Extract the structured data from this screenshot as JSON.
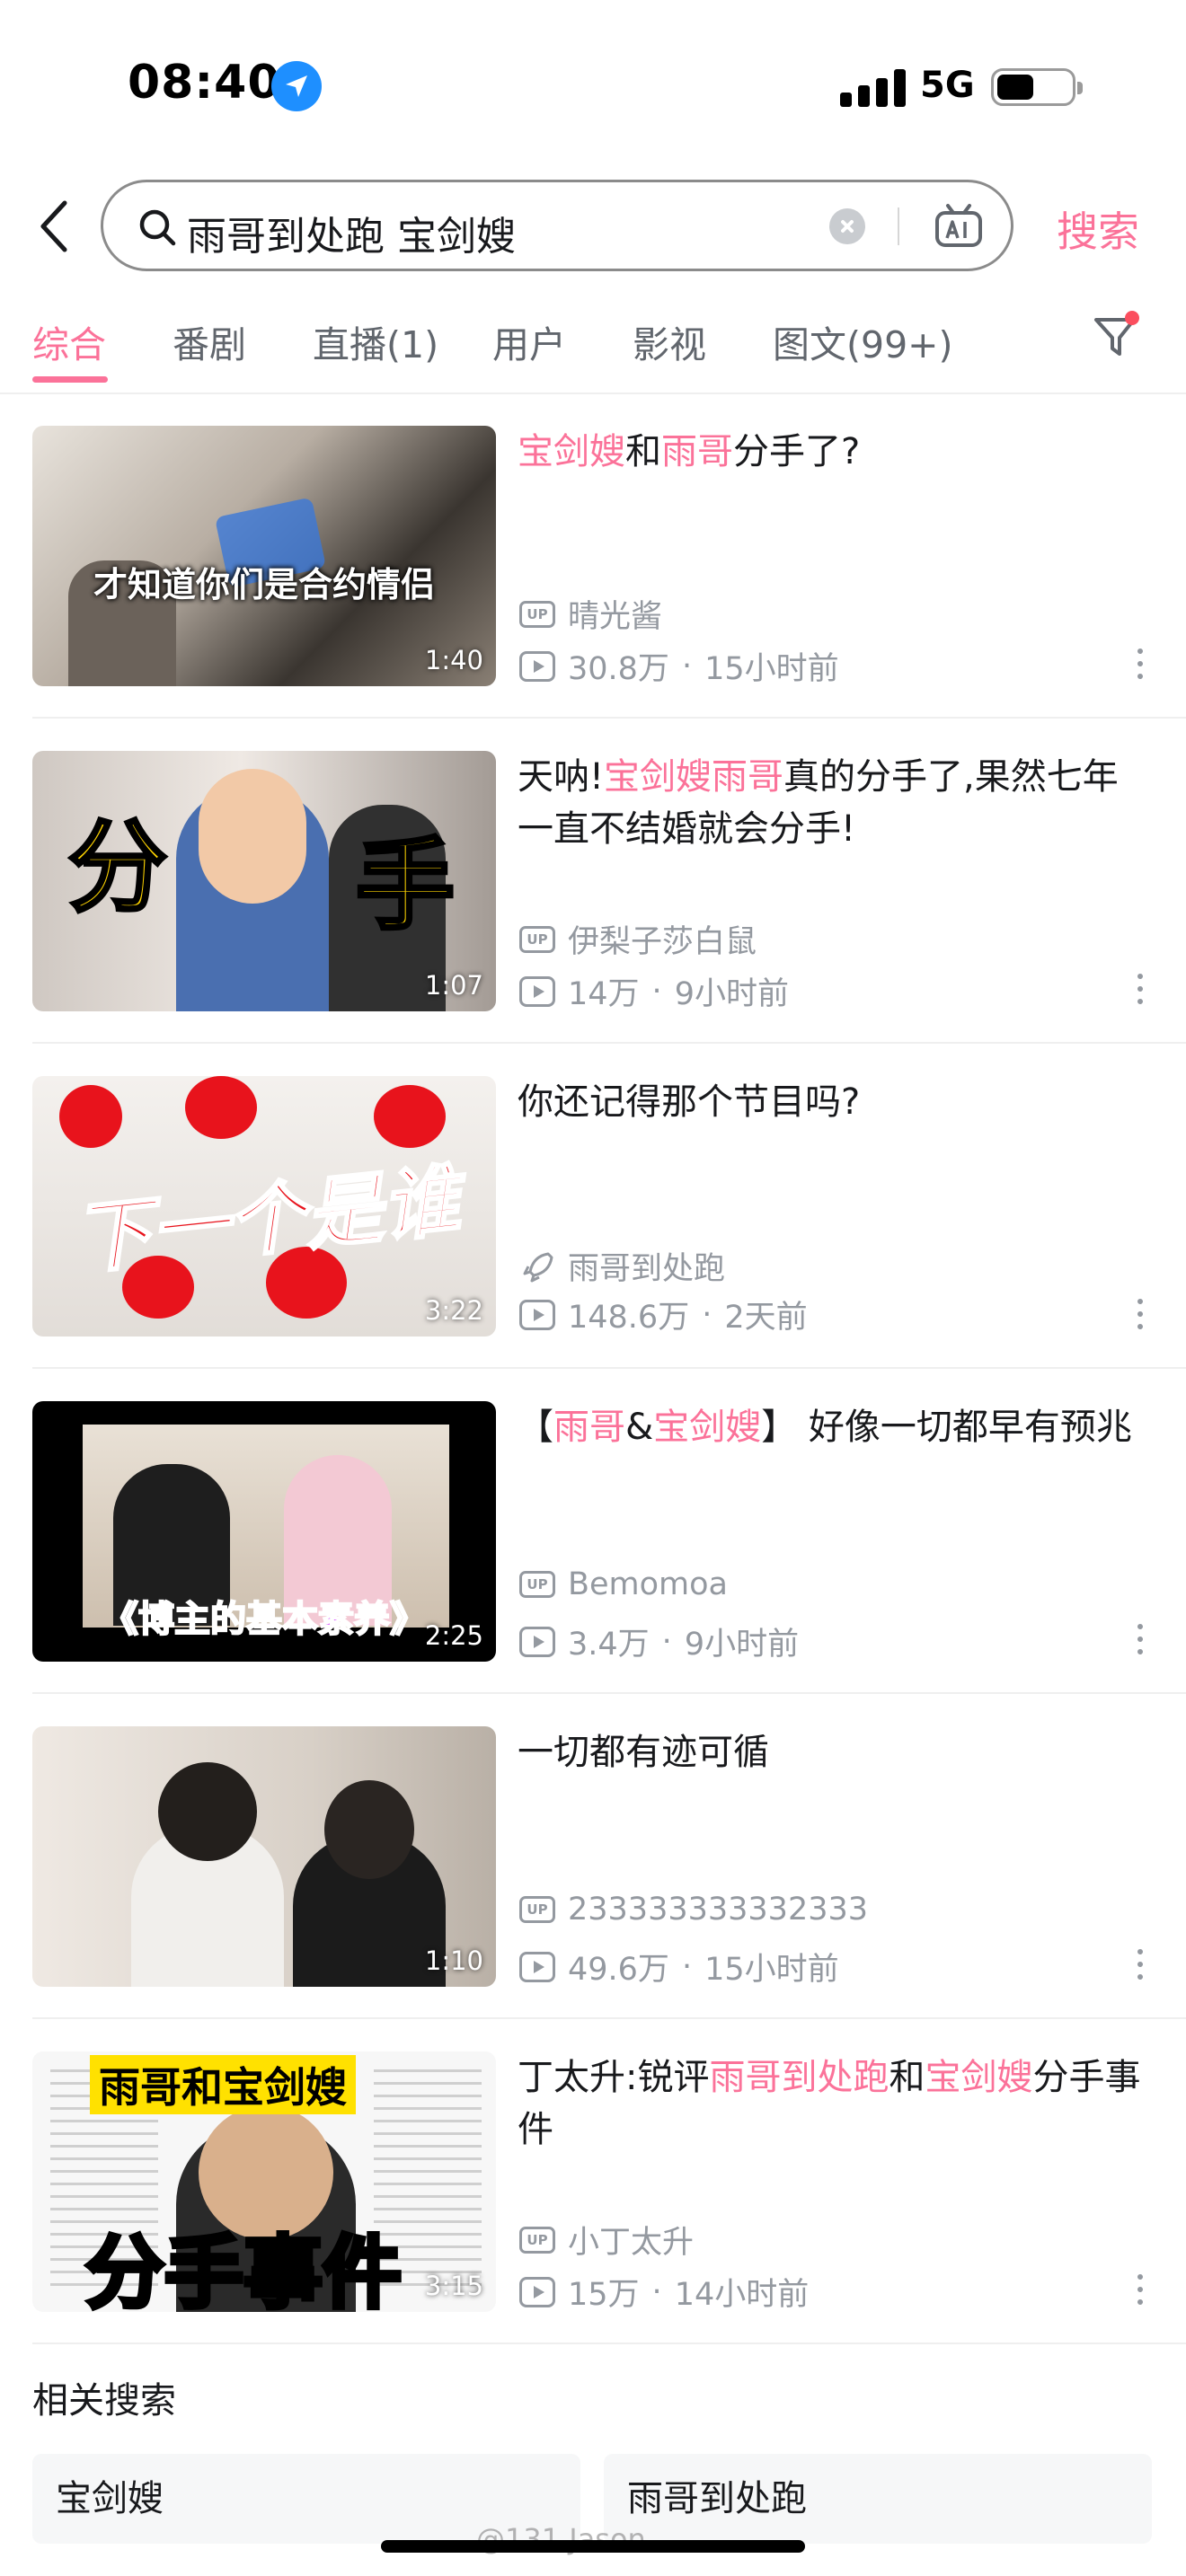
{
  "status_bar": {
    "time": "08:40",
    "network": "5G"
  },
  "search": {
    "query": "雨哥到处跑 宝剑嫂",
    "button_label": "搜索"
  },
  "tabs": [
    {
      "label": "综合",
      "active": true
    },
    {
      "label": "番剧"
    },
    {
      "label": "直播(1)"
    },
    {
      "label": "用户"
    },
    {
      "label": "影视"
    },
    {
      "label": "图文(99+)"
    }
  ],
  "videos": [
    {
      "title_parts": [
        {
          "t": "宝剑嫂",
          "hl": true
        },
        {
          "t": "和",
          "hl": false
        },
        {
          "t": "雨哥",
          "hl": true
        },
        {
          "t": "分手了?",
          "hl": false
        }
      ],
      "thumb_caption": "才知道你们是合约情侣",
      "duration": "1:40",
      "author": "晴光酱",
      "author_badge": "UP",
      "views": "30.8万",
      "time": "15小时前"
    },
    {
      "title_parts": [
        {
          "t": "天呐!",
          "hl": false
        },
        {
          "t": "宝剑嫂雨哥",
          "hl": true
        },
        {
          "t": "真的分手了,果然七年一直不结婚就会分手!",
          "hl": false
        }
      ],
      "thumb_caption": "分 手",
      "duration": "1:07",
      "author": "伊梨子莎白鼠",
      "author_badge": "UP",
      "views": "14万",
      "time": "9小时前"
    },
    {
      "title_parts": [
        {
          "t": "你还记得那个节目吗?",
          "hl": false
        }
      ],
      "thumb_caption": "下一个是谁",
      "duration": "3:22",
      "author": "雨哥到处跑",
      "author_badge": "rocket",
      "views": "148.6万",
      "time": "2天前"
    },
    {
      "title_parts": [
        {
          "t": "【",
          "hl": false
        },
        {
          "t": "雨哥",
          "hl": true
        },
        {
          "t": "&",
          "hl": false
        },
        {
          "t": "宝剑嫂",
          "hl": true
        },
        {
          "t": "】 好像一切都早有预兆",
          "hl": false
        }
      ],
      "thumb_caption": "《博主的基本素养》",
      "duration": "2:25",
      "author": "Bemomoa",
      "author_badge": "UP",
      "views": "3.4万",
      "time": "9小时前"
    },
    {
      "title_parts": [
        {
          "t": "一切都有迹可循",
          "hl": false
        }
      ],
      "thumb_caption": "",
      "duration": "1:10",
      "author": "233333333332333",
      "author_badge": "UP",
      "views": "49.6万",
      "time": "15小时前"
    },
    {
      "title_parts": [
        {
          "t": "丁太升:锐评",
          "hl": false
        },
        {
          "t": "雨哥到处跑",
          "hl": true
        },
        {
          "t": "和",
          "hl": false
        },
        {
          "t": "宝剑嫂",
          "hl": true
        },
        {
          "t": "分手事件",
          "hl": false
        }
      ],
      "thumb_caption": "雨哥和宝剑嫂 分手事件",
      "thumb_caption_top": "雨哥和宝剑嫂",
      "thumb_caption_bottom": "分手事件",
      "duration": "3:15",
      "author": "小丁太升",
      "author_badge": "UP",
      "views": "15万",
      "time": "14小时前"
    }
  ],
  "related": {
    "title": "相关搜索",
    "items": [
      "宝剑嫂",
      "雨哥到处跑"
    ]
  },
  "watermark": "@131 Jason",
  "colors": {
    "accent": "#fb7299",
    "meta": "#9499a0",
    "text": "#18191c"
  }
}
